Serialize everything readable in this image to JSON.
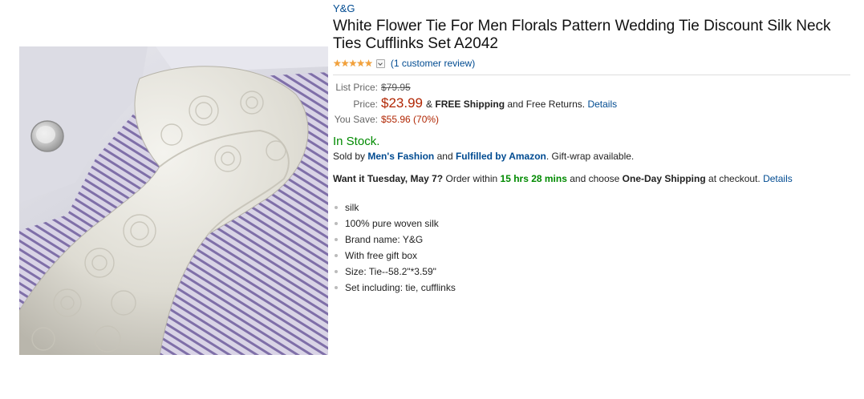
{
  "product": {
    "brand": "Y&G",
    "title": "White Flower Tie For Men Florals Pattern Wedding Tie Discount Silk Neck Ties Cufflinks Set A2042",
    "image_alt": "White floral silk tie with cufflink on lavender striped shirt"
  },
  "rating": {
    "stars": 5,
    "review_link": "(1 customer review)"
  },
  "pricing": {
    "list_label": "List Price:",
    "list_value": "$79.95",
    "price_label": "Price:",
    "price_value": "$23.99",
    "price_amp": "&",
    "free_shipping": "FREE Shipping",
    "returns_text": "and Free Returns.",
    "details_link": "Details",
    "save_label": "You Save:",
    "save_value": "$55.96 (70%)"
  },
  "availability": {
    "stock": "In Stock.",
    "sold_by_prefix": "Sold by",
    "seller": "Men's Fashion",
    "and": "and",
    "fulfilled": "Fulfilled by Amazon",
    "gift": ". Gift-wrap available."
  },
  "delivery": {
    "want_it": "Want it Tuesday, May 7?",
    "order_within": "Order within",
    "countdown": "15 hrs 28 mins",
    "choose": "and choose",
    "shipping": "One-Day Shipping",
    "checkout": "at checkout.",
    "details_link": "Details"
  },
  "features": [
    "silk",
    "100% pure woven silk",
    "Brand name: Y&G",
    "With free gift box",
    "Size: Tie--58.2\"*3.59\"",
    "Set including: tie, cufflinks"
  ],
  "colors": {
    "link": "#004b91",
    "price_red": "#b12704",
    "stock_green": "#008a00",
    "star_orange": "#f3a13c"
  }
}
